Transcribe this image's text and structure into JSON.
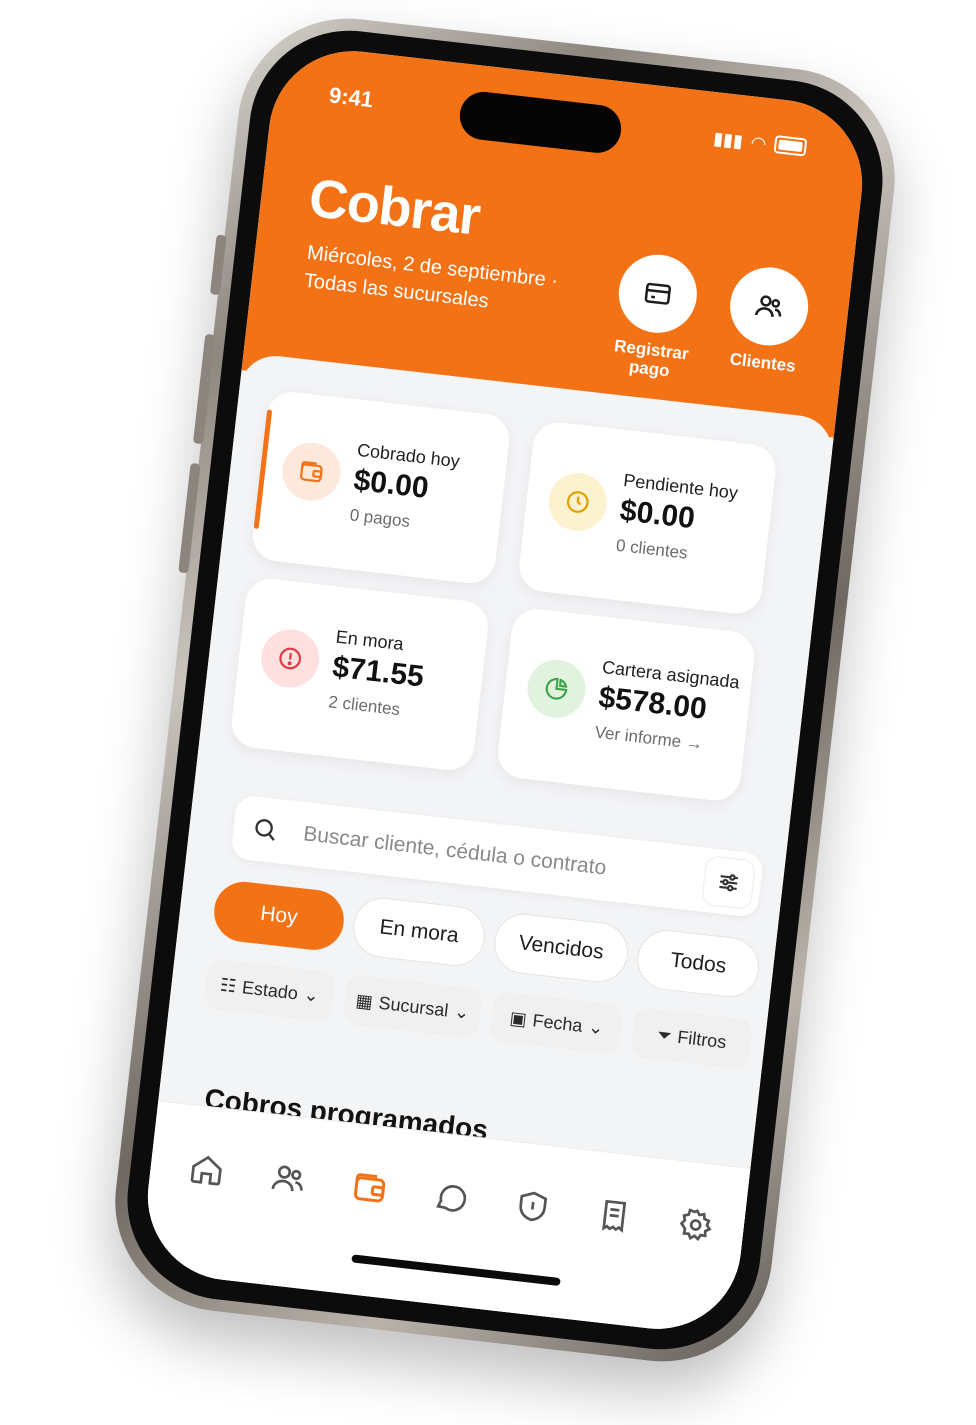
{
  "status": {
    "time": "9:41"
  },
  "header": {
    "title": "Cobrar",
    "date_line": "Miércoles, 2 de septiembre ·",
    "scope_line": "Todas las sucursales",
    "actions": [
      {
        "label_line1": "Registrar",
        "label_line2": "pago",
        "icon": "card-icon"
      },
      {
        "label_line1": "Clientes",
        "label_line2": "",
        "icon": "users-icon"
      }
    ]
  },
  "cards": [
    {
      "label": "Cobrado hoy",
      "amount": "$0.00",
      "detail": "0 pagos",
      "icon": "wallet-icon",
      "color": "#f47216",
      "tint": "#fde8dc"
    },
    {
      "label": "Pendiente hoy",
      "amount": "$0.00",
      "detail": "0 clientes",
      "icon": "clock-icon",
      "color": "#e0a100",
      "tint": "#fdf2cf"
    },
    {
      "label": "En mora",
      "amount": "$71.55",
      "detail": "2 clientes",
      "icon": "alert-icon",
      "color": "#e0393e",
      "tint": "#fde0df"
    },
    {
      "label": "Cartera asignada",
      "amount": "$578.00",
      "detail": "Ver informe →",
      "icon": "pie-icon",
      "color": "#3ea34a",
      "tint": "#e1f3df"
    }
  ],
  "search": {
    "placeholder": "Buscar cliente, cédula o contrato"
  },
  "chips": [
    "Hoy",
    "En mora",
    "Vencidos",
    "Todos"
  ],
  "filters": [
    "Estado",
    "Sucursal",
    "Fecha",
    "Filtros"
  ],
  "section_title": "Cobros programados",
  "tabs": [
    "home-icon",
    "users-icon",
    "wallet-icon",
    "chat-icon",
    "shield-icon",
    "receipt-icon",
    "settings-icon"
  ],
  "colors": {
    "accent": "#f47216"
  }
}
